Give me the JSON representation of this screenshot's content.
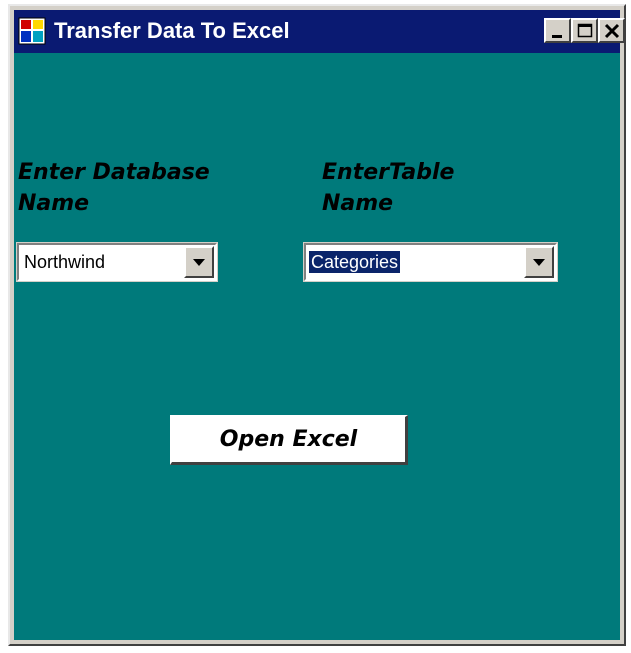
{
  "window": {
    "title": "Transfer Data To Excel"
  },
  "form": {
    "database_label": "Enter Database\nName",
    "table_label": "EnterTable\nName",
    "database_combo": {
      "value": "Northwind"
    },
    "table_combo": {
      "value": "Categories"
    },
    "open_button_label": "Open Excel"
  },
  "colors": {
    "titlebar": "#0a1a72",
    "client_background": "#007a7b",
    "selection": "#0a246a"
  },
  "icons": {
    "app": "app-window-icon",
    "minimize": "minimize-icon",
    "maximize": "maximize-icon",
    "close": "close-icon",
    "dropdown": "chevron-down-icon"
  }
}
